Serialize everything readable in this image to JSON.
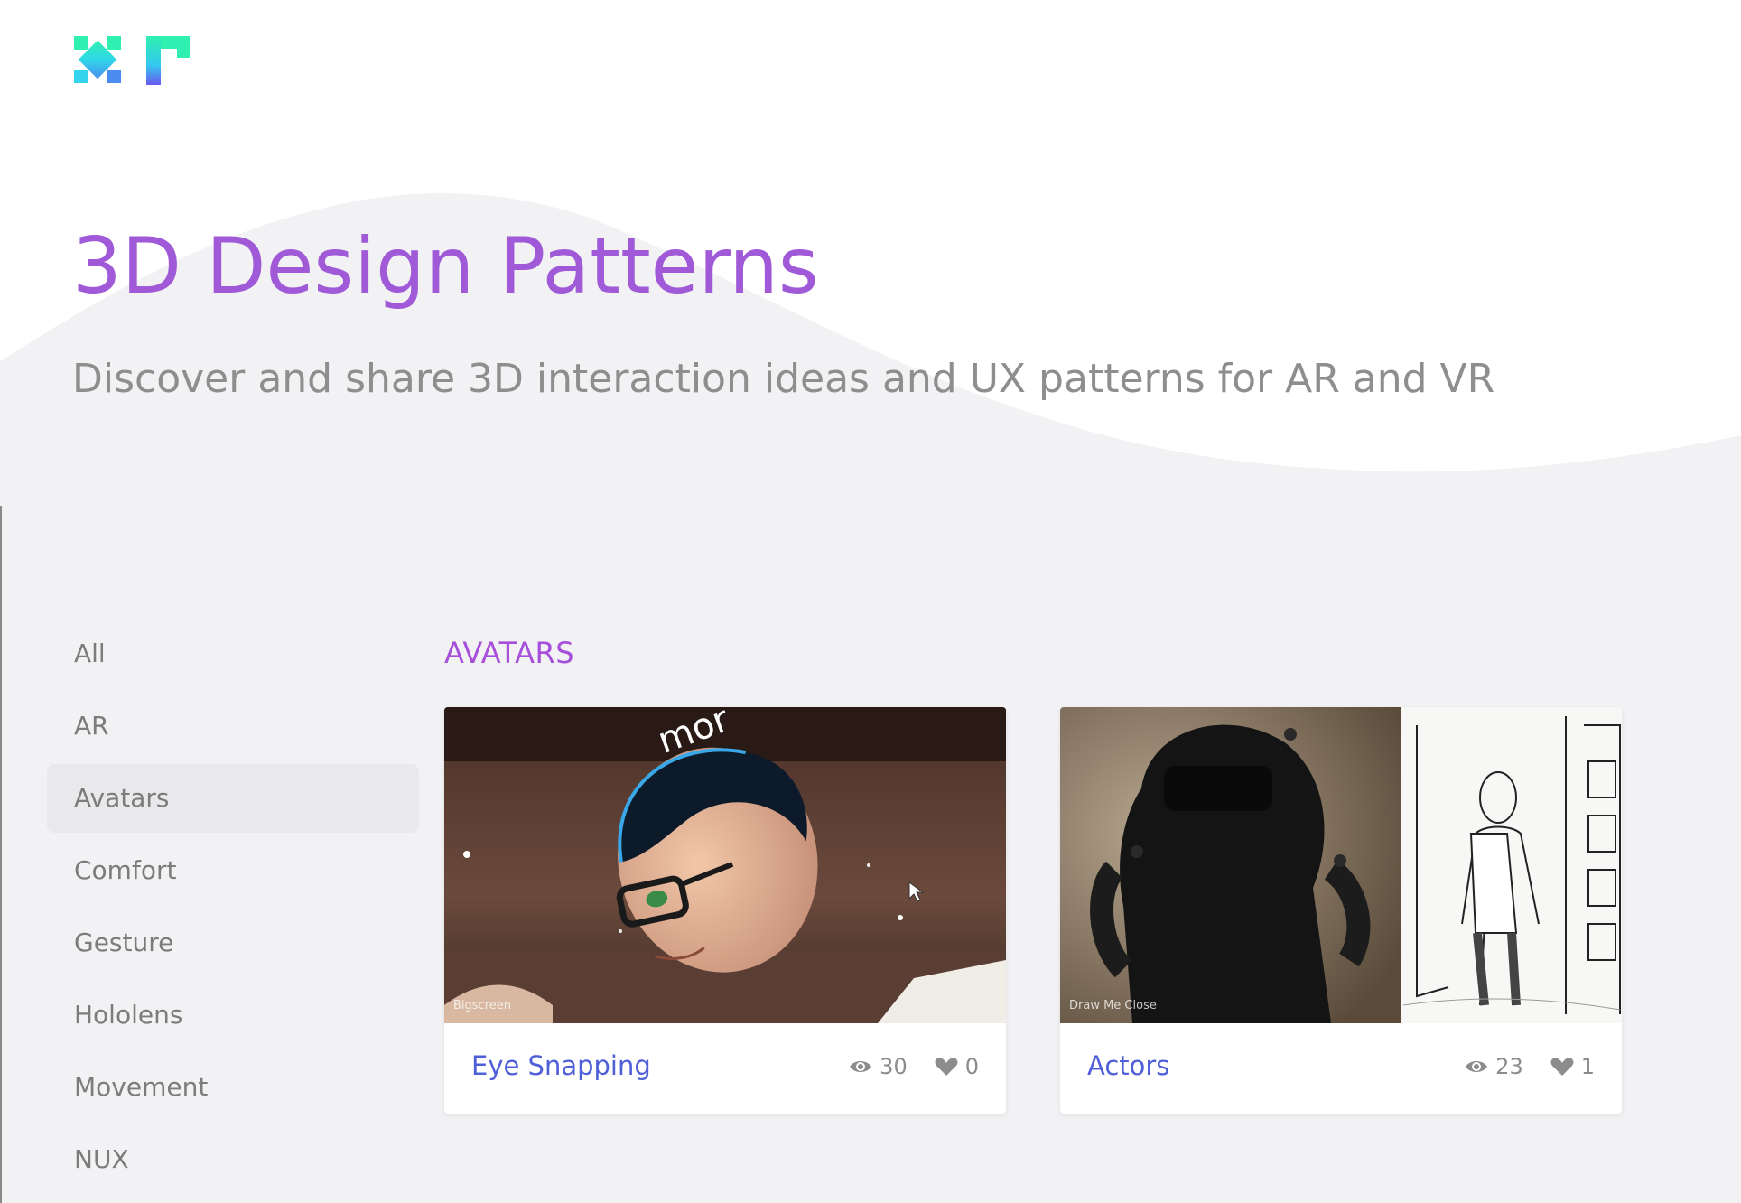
{
  "hero": {
    "title": "3D Design Patterns",
    "subtitle": "Discover and share 3D interaction ideas and UX patterns for AR and VR"
  },
  "sidebar": {
    "items": [
      {
        "label": "All"
      },
      {
        "label": "AR"
      },
      {
        "label": "Avatars",
        "active": true
      },
      {
        "label": "Comfort"
      },
      {
        "label": "Gesture"
      },
      {
        "label": "Hololens"
      },
      {
        "label": "Movement"
      },
      {
        "label": "NUX"
      }
    ]
  },
  "section": {
    "title": "AVATARS"
  },
  "cards": [
    {
      "title": "Eye Snapping",
      "thumb_caption": "Bigscreen",
      "views": "30",
      "likes": "0",
      "view_icon": "eye-icon",
      "like_icon": "heart-icon"
    },
    {
      "title": "Actors",
      "thumb_caption": "Draw Me Close",
      "views": "23",
      "likes": "1",
      "view_icon": "eye-icon",
      "like_icon": "heart-icon"
    }
  ],
  "colors": {
    "accent_purple": "#a05ad8",
    "link_blue": "#4f5fd8",
    "logo_teal": "#2ee6c8",
    "logo_blue": "#4a7cf0"
  }
}
